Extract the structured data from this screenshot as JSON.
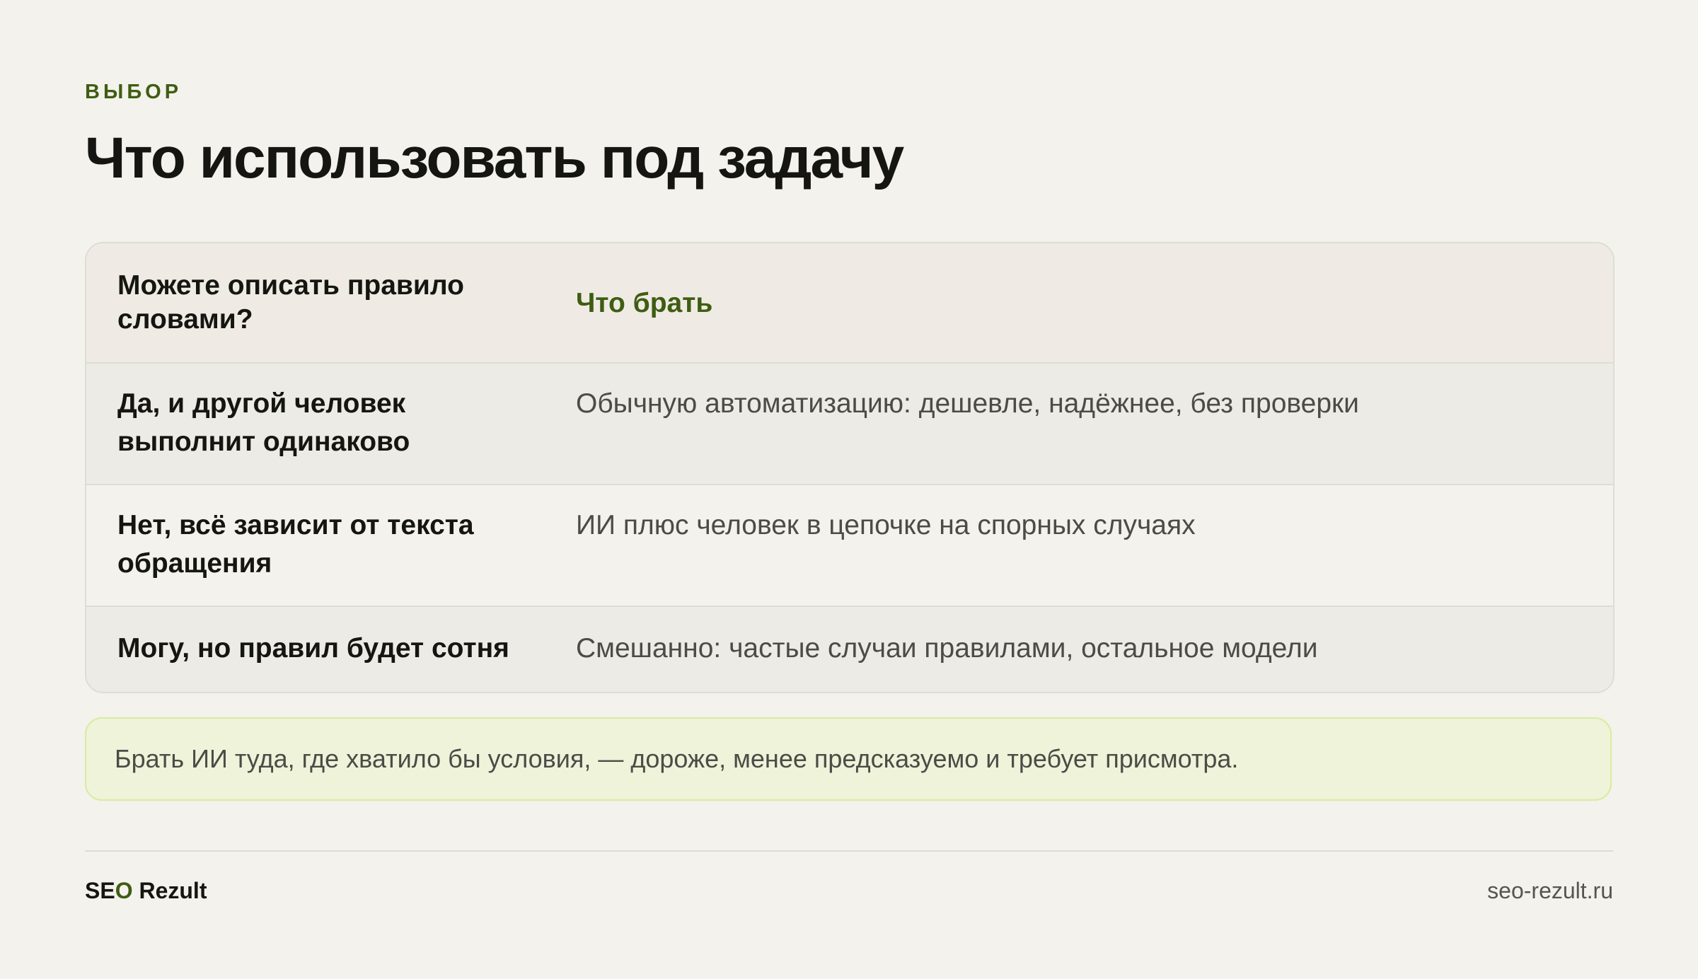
{
  "header": {
    "eyebrow": "ВЫБОР",
    "title": "Что использовать под задачу"
  },
  "table": {
    "columns": [
      "Можете описать правило словами?",
      "Что брать"
    ],
    "rows": [
      [
        "Да, и другой человек выполнит одинаково",
        "Обычную автоматизацию: дешевле, надёжнее, без проверки"
      ],
      [
        "Нет, всё зависит от текста обращения",
        "ИИ плюс человек в цепочке на спорных случаях"
      ],
      [
        "Могу, но правил будет сотня",
        "Смешанно: частые случаи правилами, остальное модели"
      ]
    ]
  },
  "note": {
    "text": "Брать ИИ туда, где хватило бы условия, — дороже, менее предсказуемо и требует присмотра."
  },
  "footer": {
    "brand_prefix": "SE",
    "brand_accent": "O",
    "brand_suffix": " Rezult",
    "site": "seo-rezult.ru"
  },
  "colors": {
    "background": "#f3f2ec",
    "accent": "#3f5d12",
    "note_background": "#eef3da",
    "note_border": "#d8ec9f"
  }
}
